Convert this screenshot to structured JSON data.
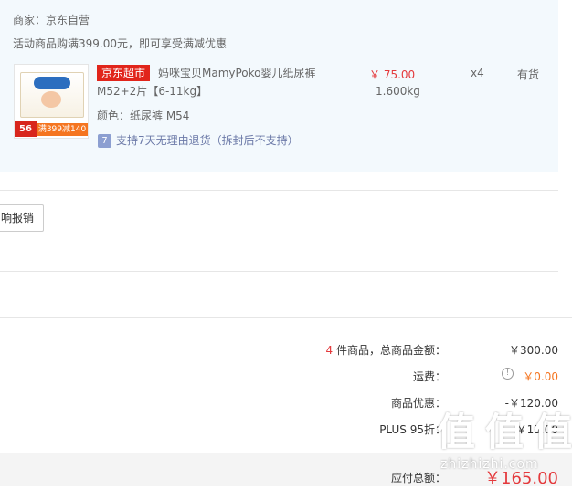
{
  "order": {
    "merchant": "商家：京东自营",
    "promo": "活动商品购满399.00元，即可享受满减优惠",
    "item": {
      "tag": "京东超市",
      "title_line1": "妈咪宝贝MamyPoko婴儿纸尿裤",
      "title_line2": "M52+2片【6-11kg】",
      "attr": "颜色：纸尿裤 M54",
      "return_icon": "7",
      "return_policy": "支持7天无理由退货（拆封后不支持）",
      "price": "￥ 75.00",
      "weight": "1.600kg",
      "qty": "x4",
      "stock": "有货",
      "thumb_count": "56",
      "thumb_deal": "满399减140"
    }
  },
  "invoice": {
    "button_label": "响报销"
  },
  "summary": {
    "goods_count": "4",
    "goods_label": " 件商品，总商品金额：",
    "goods_amount": "￥300.00",
    "shipping_label": "运费：",
    "shipping_amount": "￥0.00",
    "discount_label": "商品优惠：",
    "discount_amount": "-￥120.00",
    "plus_label": "PLUS 95折：",
    "plus_amount": "-￥15.00",
    "total_label": "应付总额：",
    "total_amount": "￥165.00"
  },
  "watermark": {
    "chars": [
      "值",
      "值",
      "值"
    ],
    "url": "zhizhizhi.com"
  },
  "colors": {
    "accent_red": "#e4393c",
    "tag_red": "#e1251b",
    "orange": "#f57520",
    "panel_bg": "#f3f9fd"
  }
}
